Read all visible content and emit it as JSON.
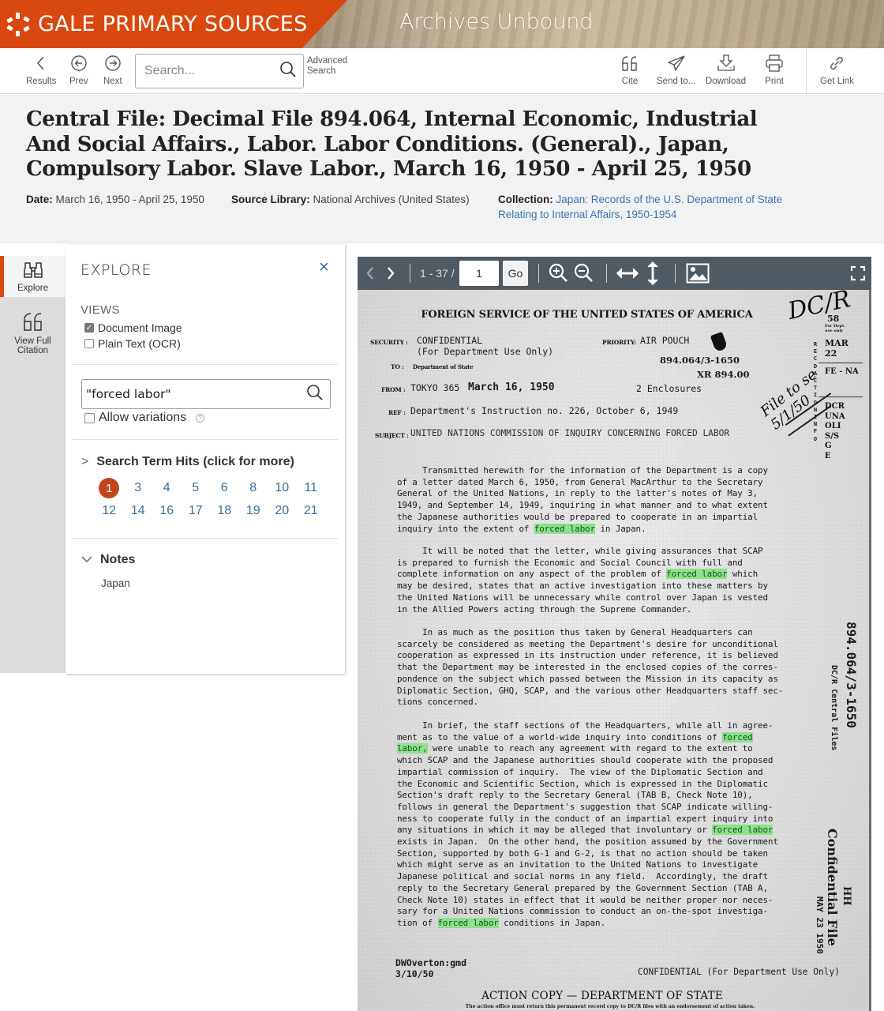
{
  "banner": {
    "brand": "GALE PRIMARY SOURCES",
    "product": "Archives Unbound",
    "brand_color": "#d9480f"
  },
  "toolbar": {
    "results_label": "Results",
    "prev_label": "Prev",
    "next_label": "Next",
    "search_placeholder": "Search...",
    "search_value": "",
    "advanced_search_line1": "Advanced",
    "advanced_search_line2": "Search",
    "cite_label": "Cite",
    "send_label": "Send to...",
    "download_label": "Download",
    "print_label": "Print",
    "get_link_label": "Get Link"
  },
  "document": {
    "title": "Central File: Decimal File 894.064, Internal Economic, Industrial And Social Affairs., Labor. Labor Conditions. (General)., Japan, Compulsory Labor. Slave Labor., March 16, 1950 - April 25, 1950",
    "date_label": "Date:",
    "date_value": "March 16, 1950 - April 25, 1950",
    "source_label": "Source Library:",
    "source_value": "National Archives (United States)",
    "collection_label": "Collection:",
    "collection_line1": "Japan: Records of the U.S. Department of State",
    "collection_line2": "Relating to Internal Affairs, 1950-1954"
  },
  "rail": {
    "explore_label": "Explore",
    "citation_line1": "View Full",
    "citation_line2": "Citation"
  },
  "explore": {
    "title": "EXPLORE",
    "close_label": "×",
    "views_label": "VIEWS",
    "views": [
      {
        "label": "Document Image",
        "checked": true
      },
      {
        "label": "Plain Text (OCR)",
        "checked": false
      }
    ],
    "term_value": "\"forced labor\"",
    "allow_variations_label": "Allow variations",
    "allow_variations_checked": false,
    "hits_heading": "Search Term Hits (click for more)",
    "hits": [
      "1",
      "3",
      "4",
      "5",
      "6",
      "8",
      "10",
      "11",
      "12",
      "14",
      "16",
      "17",
      "18",
      "19",
      "20",
      "21"
    ],
    "active_hit": "1",
    "notes_heading": "Notes",
    "notes_value": "Japan"
  },
  "viewer": {
    "page_range": "1 - 37 /",
    "page_value": "1",
    "go_label": "Go",
    "doc": {
      "header": "FOREIGN SERVICE OF THE UNITED STATES OF AMERICA",
      "security_label": "SECURITY :",
      "security_value1": "CONFIDENTIAL",
      "security_value2": "(For Department Use Only)",
      "priority_label": "PRIORITY:",
      "priority_value": "AIR POUCH",
      "to_label": "TO :",
      "to_value": "Department of State",
      "file_no1": "894.064/3-1650",
      "file_no2": "XR 894.00",
      "from_label": "FROM :",
      "from_value": "TOKYO 365",
      "from_date": "March 16, 1950",
      "enclosures": "2 Enclosures",
      "ref_label": "REF :",
      "ref_value": "Department's Instruction no. 226, October 6, 1949",
      "subject_label": "SUBJECT :",
      "subject_value": "UNITED NATIONS COMMISSION OF INQUIRY CONCERNING FORCED LABOR",
      "para1": [
        "     Transmitted herewith for the information of the Department is a copy",
        "of a letter dated March 6, 1950, from General MacArthur to the Secretary",
        "General of the United Nations, in reply to the latter's notes of May 3,",
        "1949, and September 14, 1949, inquiring in what manner and to what extent",
        "the Japanese authorities would be prepared to cooperate in an impartial",
        "inquiry into the extent of |forced labor| in Japan."
      ],
      "para2": [
        "     It will be noted that the letter, while giving assurances that SCAP",
        "is prepared to furnish the Economic and Social Council with full and",
        "complete information on any aspect of the problem of |forced labor| which",
        "may be desired, states that an active investigation into these matters by",
        "the United Nations will be unnecessary while control over Japan is vested",
        "in the Allied Powers acting through the Supreme Commander."
      ],
      "para3": [
        "     In as much as the position thus taken by General Headquarters can",
        "scarcely be considered as meeting the Department's desire for unconditional",
        "cooperation as expressed in its instruction under reference, it is believed",
        "that the Department may be interested in the enclosed copies of the corres-",
        "pondence on the subject which passed between the Mission in its capacity as",
        "Diplomatic Section, GHQ, SCAP, and the various other Headquarters staff sec-",
        "tions concerned."
      ],
      "para4": [
        "     In brief, the staff sections of the Headquarters, while all in agree-",
        "ment as to the value of a world-wide inquiry into conditions of |forced|",
        "|labor,| were unable to reach any agreement with regard to the extent to",
        "which SCAP and the Japanese authorities should cooperate with the proposed",
        "impartial commission of inquiry.  The view of the Diplomatic Section and",
        "the Economic and Scientific Section, which is expressed in the Diplomatic",
        "Section's draft reply to the Secretary General (TAB B, Check Note 10),",
        "follows in general the Department's suggestion that SCAP indicate willing-",
        "ness to cooperate fully in the conduct of an impartial expert inquiry into",
        "any situations in which it may be alleged that involuntary or |forced labor|",
        "exists in Japan.  On the other hand, the position assumed by the Government",
        "Section, supported by both G-1 and G-2, is that no action should be taken",
        "which might serve as an invitation to the United Nations to investigate",
        "Japanese political and social norms in any field.  Accordingly, the draft",
        "reply to the Secretary General prepared by the Government Section (TAB A,",
        "Check Note 10) states in effect that it would be neither proper nor neces-",
        "sary for a United Nations commission to conduct an on-the-spot investiga-",
        "tion of |forced labor| conditions in Japan."
      ],
      "drafter": "DWOverton:gmd",
      "draft_date": "3/10/50",
      "footer_confidential": "CONFIDENTIAL (For Department Use Only)",
      "footer_title": "ACTION COPY — DEPARTMENT OF STATE",
      "footer_sub": "The action office must return this permanent record copy to DC/R files with an endorsement of action taken.",
      "hand_top": "DC/R",
      "margin_stamp": [
        "58",
        "For Dept.",
        "use only",
        "MAR",
        "22",
        "FE - NA",
        "DCR",
        "UNA",
        "OLI",
        "S/S",
        "G",
        "E"
      ],
      "margin_vertical_letters": "RECD ACTION INFO",
      "handwriting_file": "File to se 5/1/50",
      "vertical_file_no": "894.064/3-1650",
      "vertical_dcr": "DC/R Central Files",
      "vertical_confidential": "Confidential File",
      "vertical_initials": "HH",
      "vertical_date": "MAY 23 1950",
      "highlight_color": "#8fe08f"
    }
  }
}
